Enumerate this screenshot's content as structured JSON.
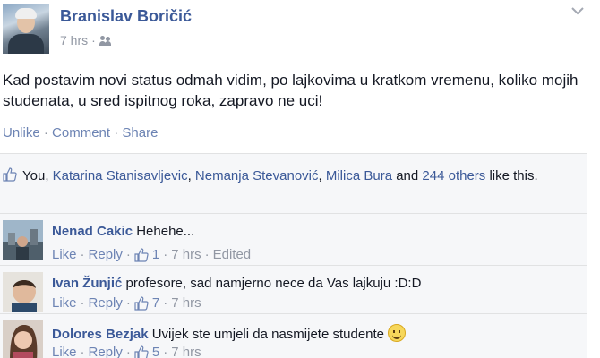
{
  "post": {
    "author": "Branislav Boričić",
    "time": "7 hrs",
    "meta_sep": "·",
    "privacy_icon": "friends-icon",
    "menu_icon": "chevron-down-icon",
    "status_text": "Kad postavim novi status odmah vidim, po lajkovima u kratkom vremenu, koliko mojih studenata, u sred ispitnog roka, zapravo ne uci!",
    "actions": {
      "unlike": "Unlike",
      "comment": "Comment",
      "share": "Share",
      "sep": " · "
    }
  },
  "likes": {
    "you": "You,",
    "names": [
      "Katarina Stanisavljevic",
      "Nemanja Stevanović",
      "Milica Bura"
    ],
    "and": "and",
    "others": "244 others",
    "tail": "like this."
  },
  "comments": [
    {
      "name": "Nenad Cakic",
      "text": "Hehehe...",
      "like": "Like",
      "reply": "Reply",
      "likes": "1",
      "time": "7 hrs",
      "edited": "Edited"
    },
    {
      "name": "Ivan Žunjić",
      "text": "profesore, sad namjerno nece da Vas lajkuju :D:D",
      "like": "Like",
      "reply": "Reply",
      "likes": "7",
      "time": "7 hrs"
    },
    {
      "name": "Dolores Bezjak",
      "text": "Uvijek ste umjeli da nasmijete studente",
      "like": "Like",
      "reply": "Reply",
      "likes": "5",
      "time": "7 hrs"
    }
  ],
  "colors": {
    "link": "#3b5998",
    "action": "#6d84b4",
    "meta": "#9197a3",
    "feedback_bg": "#f6f7f9"
  }
}
